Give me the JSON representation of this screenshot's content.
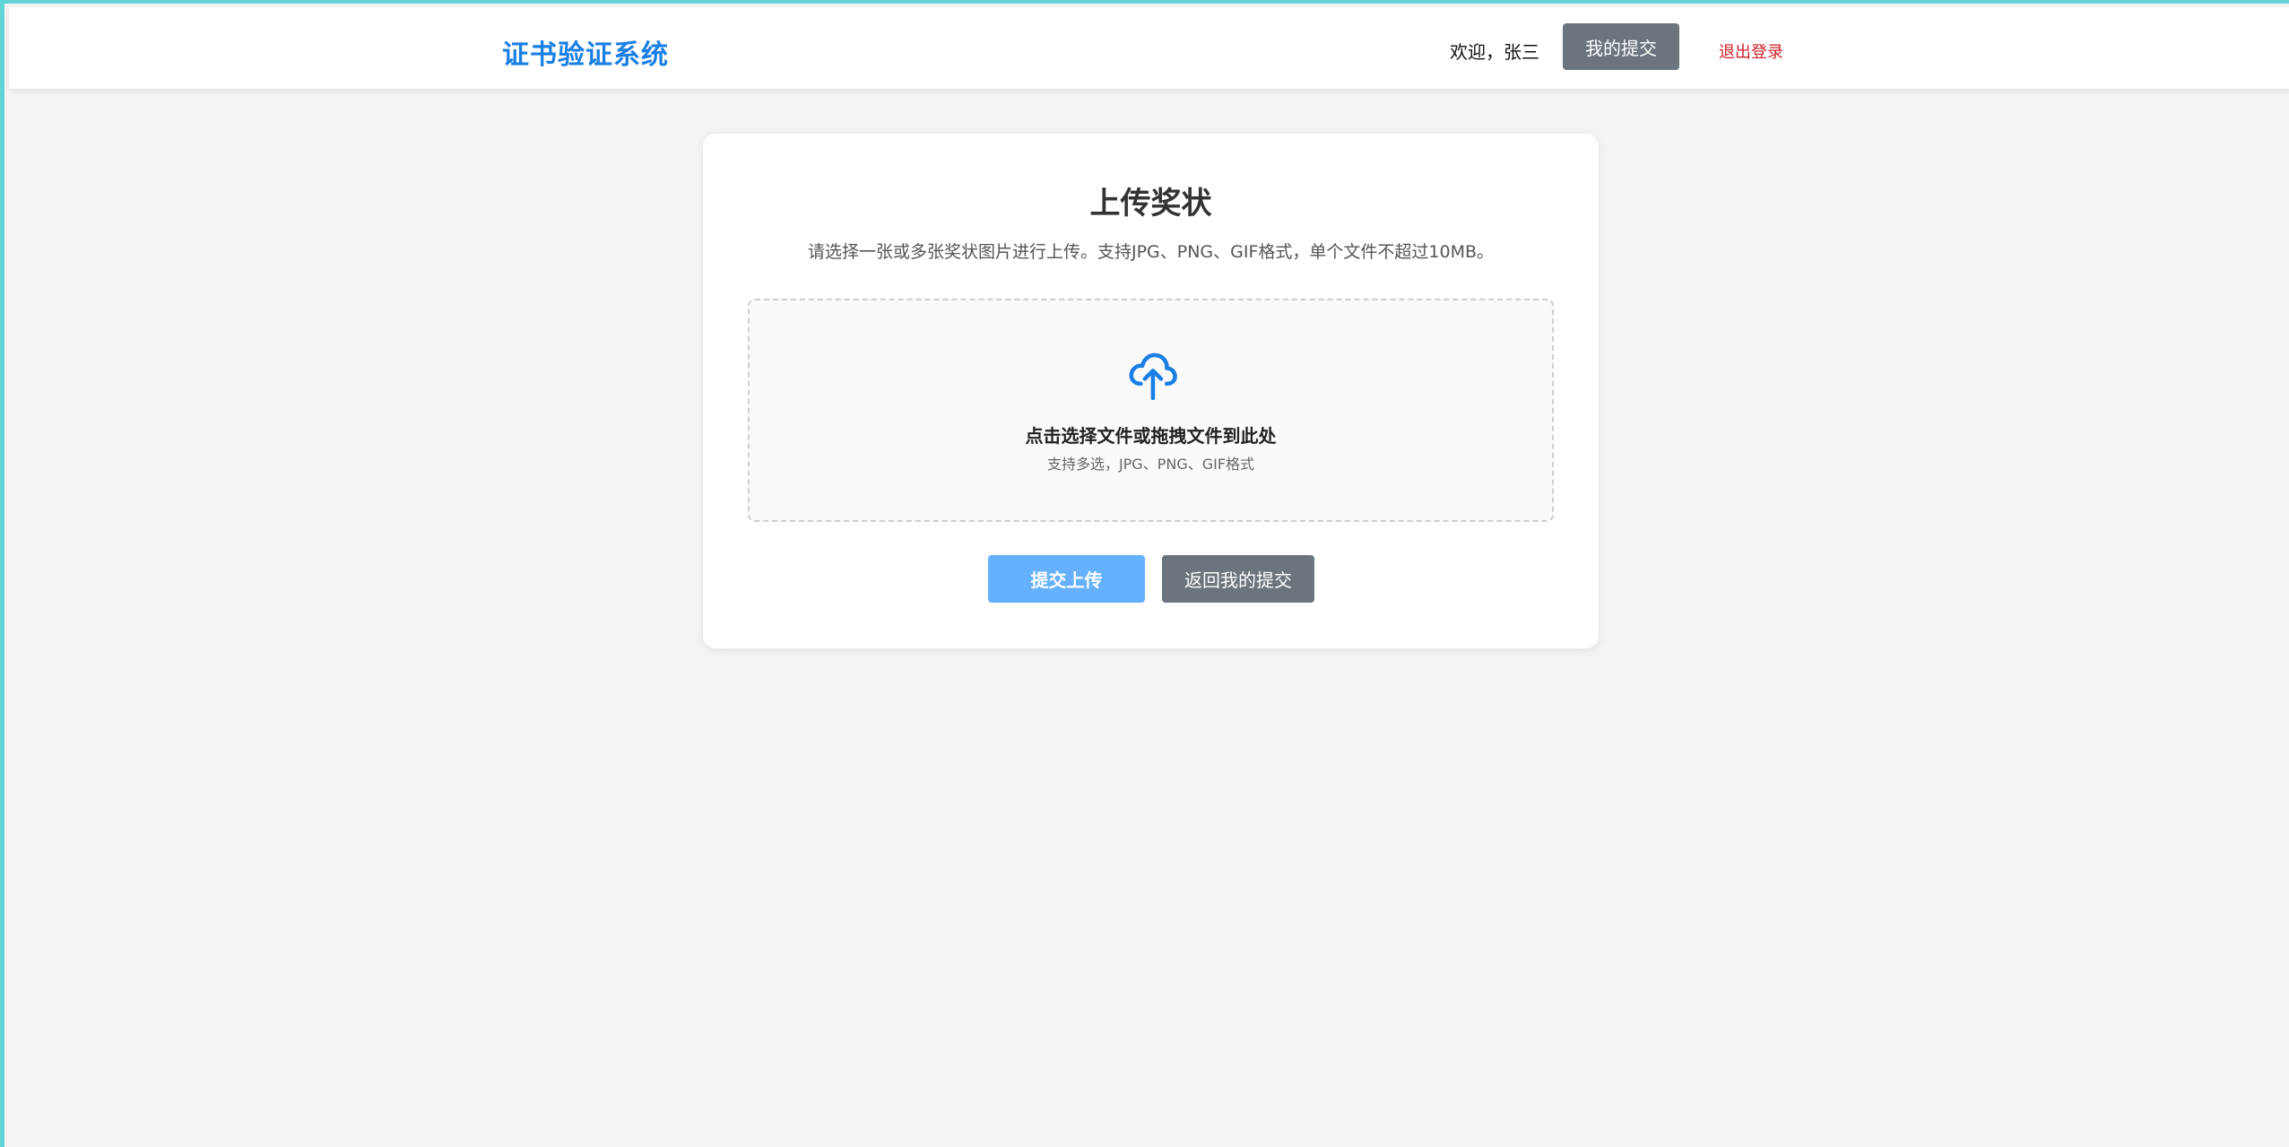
{
  "header": {
    "brand": "证书验证系统",
    "welcome": "欢迎，张三",
    "my_submissions_label": "我的提交",
    "logout_label": "退出登录"
  },
  "card": {
    "title": "上传奖状",
    "description": "请选择一张或多张奖状图片进行上传。支持JPG、PNG、GIF格式，单个文件不超过10MB。",
    "dropzone": {
      "icon": "cloud-upload-icon",
      "main_text": "点击选择文件或拖拽文件到此处",
      "sub_text": "支持多选，JPG、PNG、GIF格式"
    },
    "submit_label": "提交上传",
    "back_label": "返回我的提交"
  },
  "colors": {
    "brand": "#1a7fe4",
    "primary_disabled": "#66b1ff",
    "secondary": "#6c757d",
    "danger": "#d0202a",
    "frame_accent": "#62d3d3"
  }
}
